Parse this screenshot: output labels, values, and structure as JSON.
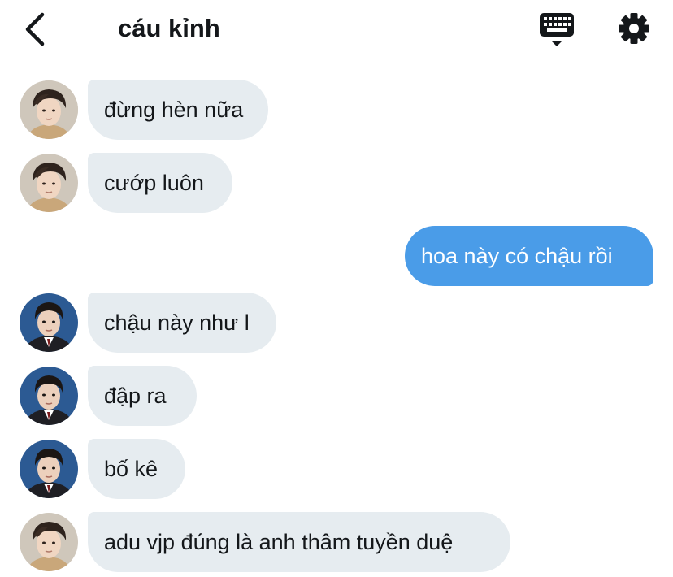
{
  "header": {
    "title": "cáu kỉnh",
    "back_icon": "chevron-left-icon",
    "keyboard_icon": "keyboard-icon",
    "settings_icon": "gear-icon"
  },
  "colors": {
    "incoming_bubble": "#e6ecf0",
    "outgoing_bubble": "#4a9ce8"
  },
  "messages": [
    {
      "direction": "incoming",
      "sender_avatar": "avatar-a",
      "text": "đừng hèn nữa"
    },
    {
      "direction": "incoming",
      "sender_avatar": "avatar-a",
      "text": "cướp luôn"
    },
    {
      "direction": "outgoing",
      "text": "hoa này có chậu rồi"
    },
    {
      "direction": "incoming",
      "sender_avatar": "avatar-b",
      "text": "chậu này như l"
    },
    {
      "direction": "incoming",
      "sender_avatar": "avatar-b",
      "text": "đập ra"
    },
    {
      "direction": "incoming",
      "sender_avatar": "avatar-b",
      "text": "bố kê"
    },
    {
      "direction": "incoming",
      "sender_avatar": "avatar-a",
      "text": "adu vjp đúng là anh thâm tuyền duệ"
    }
  ]
}
